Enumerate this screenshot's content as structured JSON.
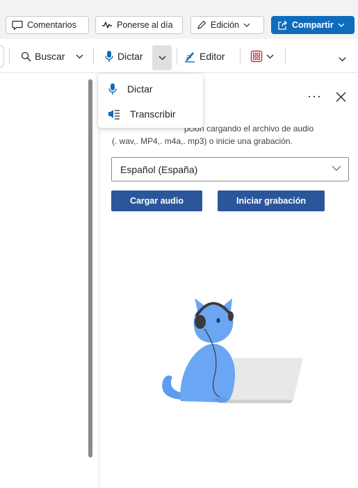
{
  "topbar": {
    "comments_label": "Comentarios",
    "catchup_label": "Ponerse al día",
    "editing_label": "Edición",
    "share_label": "Compartir"
  },
  "ribbon": {
    "find_label": "Buscar",
    "dictate_label": "Dictar",
    "editor_label": "Editor"
  },
  "dictate_menu": {
    "items": [
      {
        "label": "Dictar",
        "icon": "microphone-icon"
      },
      {
        "label": "Transcribir",
        "icon": "transcribe-icon"
      }
    ]
  },
  "transcribe_pane": {
    "more_label": "···",
    "description_line1": "pción cargando el archivo de audio",
    "description_line2": "(. wav,. MP4,. m4a,. mp3) o inicie una grabación.",
    "language_value": "Español (España)",
    "upload_label": "Cargar audio",
    "record_label": "Iniciar grabación"
  },
  "colors": {
    "share_button": "#0f6cbd",
    "primary_button": "#2b579a",
    "accent_icon": "#0f6cbd",
    "cat": "#5b9bf0"
  }
}
